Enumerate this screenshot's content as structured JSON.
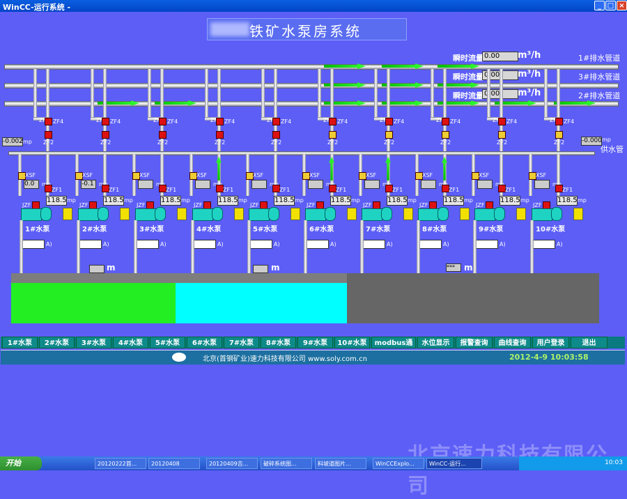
{
  "window": {
    "title": "WinCC-运行系统 -",
    "btn_min": "_",
    "btn_max": "□",
    "btn_close": "×"
  },
  "main_title": "铁矿水泵房系统",
  "pipelines": [
    {
      "name": "1#排水管道",
      "flow_label": "瞬时流量",
      "flow_value": "0.00",
      "unit": "m³/h"
    },
    {
      "name": "3#排水管道",
      "flow_label": "瞬时流量",
      "flow_value": "0.00",
      "unit": "m³/h"
    },
    {
      "name": "2#排水管道",
      "flow_label": "瞬时流量",
      "flow_value": "0.00",
      "unit": "m³/h"
    }
  ],
  "supply": {
    "left_value": "-0.002",
    "right_value": "-0.000",
    "unit": "mp",
    "label": "供水管"
  },
  "valve_labels": {
    "zf3": "ZF3",
    "zf4": "ZF4",
    "zf2": "ZF2",
    "xsf": "XSF",
    "zf1": "ZF1",
    "jzf": "JZF",
    "mp": "mp",
    "ai": "A)"
  },
  "pumps": [
    {
      "label": "1#水泵",
      "value": "118.5",
      "pressure": "0.0"
    },
    {
      "label": "2#水泵",
      "value": "118.5",
      "pressure": "-0.1"
    },
    {
      "label": "3#水泵",
      "value": "118.5",
      "pressure": ""
    },
    {
      "label": "4#水泵",
      "value": "118.5",
      "pressure": ""
    },
    {
      "label": "5#水泵",
      "value": "118.5",
      "pressure": ""
    },
    {
      "label": "6#水泵",
      "value": "118.5",
      "pressure": ""
    },
    {
      "label": "7#水泵",
      "value": "118.5",
      "pressure": ""
    },
    {
      "label": "8#水泵",
      "value": "118.5",
      "pressure": ""
    },
    {
      "label": "9#水泵",
      "value": "118.5",
      "pressure": ""
    },
    {
      "label": "10#水泵",
      "value": "118.5",
      "pressure": ""
    }
  ],
  "tank_level_unit": "m",
  "tank_levels": [
    "",
    "",
    "***"
  ],
  "nav": [
    "1#水泵",
    "2#水泵",
    "3#水泵",
    "4#水泵",
    "5#水泵",
    "6#水泵",
    "7#水泵",
    "8#水泵",
    "9#水泵",
    "10#水泵",
    "modbus通信",
    "水位显示",
    "报警查询",
    "曲线查询",
    "用户登录",
    "退出"
  ],
  "footer": {
    "company": "北京(首钢矿业)速力科技有限公司   www.soly.com.cn",
    "datetime": "2012-4-9 10:03:58"
  },
  "taskbar": {
    "start": "开始",
    "items": [
      "20120222首...",
      "20120408",
      "20120409吉...",
      "破碎系统图...",
      "料坡道图片...",
      "WinCCExplo...",
      "WinCC-运行..."
    ],
    "clock": "10:03"
  },
  "watermark": "北京速力科技有限公司",
  "colors": {
    "background": "#5c5ef6",
    "tank_green": "#22ee22",
    "tank_cyan": "#00ffff",
    "tank_gray": "#666666",
    "nav": "#0e8a8a"
  }
}
